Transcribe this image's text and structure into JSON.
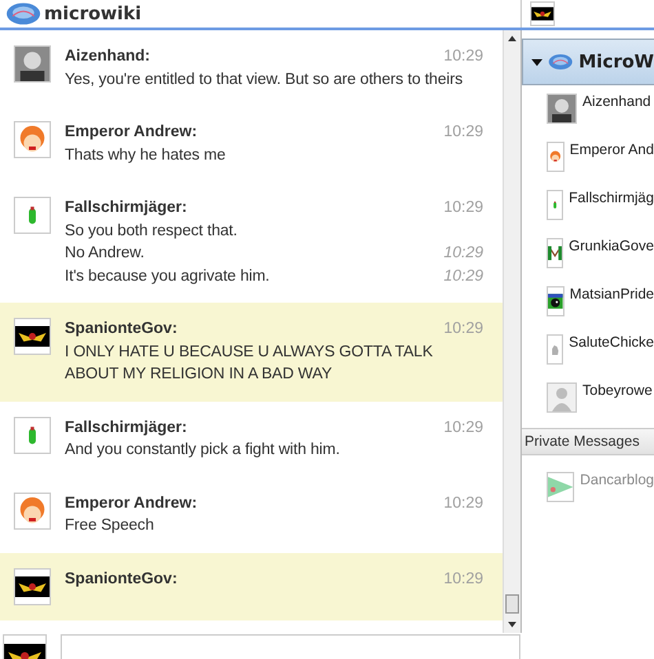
{
  "header": {
    "logo_text": "microwiki"
  },
  "messages": [
    {
      "author": "Aizenhand:",
      "kind": "photo",
      "time": "10:29",
      "highlighted": false,
      "lines": [
        {
          "text": "Yes, you're entitled to that view. But so are others to theirs"
        }
      ]
    },
    {
      "author": "Emperor Andrew:",
      "kind": "cartoon",
      "time": "10:29",
      "highlighted": false,
      "lines": [
        {
          "text": "Thats why he hates me"
        }
      ]
    },
    {
      "author": "Fallschirmjäger:",
      "kind": "figure",
      "time": "10:29",
      "highlighted": false,
      "lines": [
        {
          "text": "So you both respect that."
        },
        {
          "text": "No Andrew.",
          "time": "10:29"
        },
        {
          "text": "It's because you agrivate him.",
          "time": "10:29"
        }
      ]
    },
    {
      "author": "SpanionteGov:",
      "kind": "emblem",
      "time": "10:29",
      "highlighted": true,
      "lines": [
        {
          "text": "I ONLY HATE U BECAUSE U ALWAYS GOTTA TALK ABOUT MY RELIGION IN A BAD WAY"
        }
      ]
    },
    {
      "author": "Fallschirmjäger:",
      "kind": "figure",
      "time": "10:29",
      "highlighted": false,
      "lines": [
        {
          "text": "And you constantly pick a fight with him."
        }
      ]
    },
    {
      "author": "Emperor Andrew:",
      "kind": "cartoon",
      "time": "10:29",
      "highlighted": false,
      "lines": [
        {
          "text": "Free Speech"
        }
      ]
    },
    {
      "author": "SpanionteGov:",
      "kind": "emblem",
      "time": "10:29",
      "highlighted": true
    }
  ],
  "sidebar": {
    "group": {
      "logo_text": "MicroW",
      "expanded": true
    },
    "members": [
      {
        "name": "Aizenhand",
        "kind": "photo",
        "offline": false
      },
      {
        "name": "Emperor And",
        "kind": "cartoon",
        "offline": false
      },
      {
        "name": "Fallschirmjäg",
        "kind": "figure",
        "offline": false
      },
      {
        "name": "GrunkiaGove",
        "kind": "flag",
        "offline": false
      },
      {
        "name": "MatsianPride",
        "kind": "bird",
        "offline": false
      },
      {
        "name": "SaluteChicke",
        "kind": "statue",
        "offline": false
      },
      {
        "name": "Tobeyrowe",
        "kind": "silhouette",
        "offline": false
      }
    ],
    "private_title": "Private Messages",
    "private": [
      {
        "name": "Dancarblog",
        "kind": "pennant",
        "offline": true
      }
    ]
  }
}
